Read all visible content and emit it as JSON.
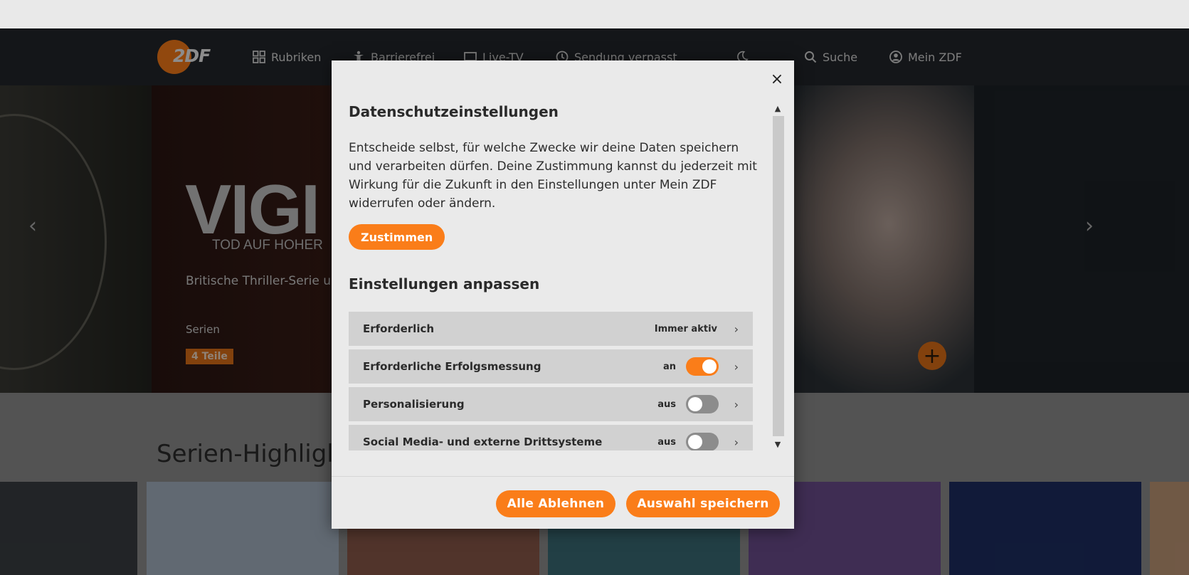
{
  "nav": {
    "logo": "2DF",
    "items": [
      {
        "label": "Rubriken",
        "icon": "grid-icon"
      },
      {
        "label": "Barrierefrei",
        "icon": "accessibility-icon"
      },
      {
        "label": "Live-TV",
        "icon": "tv-icon"
      },
      {
        "label": "Sendung verpasst",
        "icon": "clock-icon"
      }
    ],
    "dark_mode_icon": "moon-icon",
    "search_label": "Suche",
    "account_label": "Mein ZDF"
  },
  "hero": {
    "title": "VIGI",
    "subtitle": "TOD AUF HOHER",
    "description": "Britische Thriller-Serie u einem Atom-U-Boot eine",
    "category": "Serien",
    "badge": "4 Teile"
  },
  "row": {
    "heading": "Serien-Highligl"
  },
  "modal": {
    "close_glyph": "×",
    "title": "Datenschutzeinstellungen",
    "text": "Entscheide selbst, für welche Zwecke wir deine Daten speichern und verarbeiten dürfen. Deine Zustimmung kannst du jederzeit mit Wirkung für die Zukunft in den Einstellungen unter Mein ZDF widerrufen oder ändern.",
    "agree_label": "Zustimmen",
    "settings_title": "Einstellungen anpassen",
    "categories": [
      {
        "label": "Erforderlich",
        "state": "Immer aktiv",
        "toggle": null
      },
      {
        "label": "Erforderliche Erfolgsmessung",
        "state": "an",
        "toggle": true
      },
      {
        "label": "Personalisierung",
        "state": "aus",
        "toggle": false
      },
      {
        "label": "Social Media- und externe Drittsysteme",
        "state": "aus",
        "toggle": false
      }
    ],
    "reject_all_label": "Alle Ablehnen",
    "save_selection_label": "Auswahl speichern"
  },
  "colors": {
    "accent": "#fa7d19",
    "nav_bg": "#24272b",
    "modal_bg": "#eaeaea",
    "row_bg": "#d1d1d1"
  }
}
